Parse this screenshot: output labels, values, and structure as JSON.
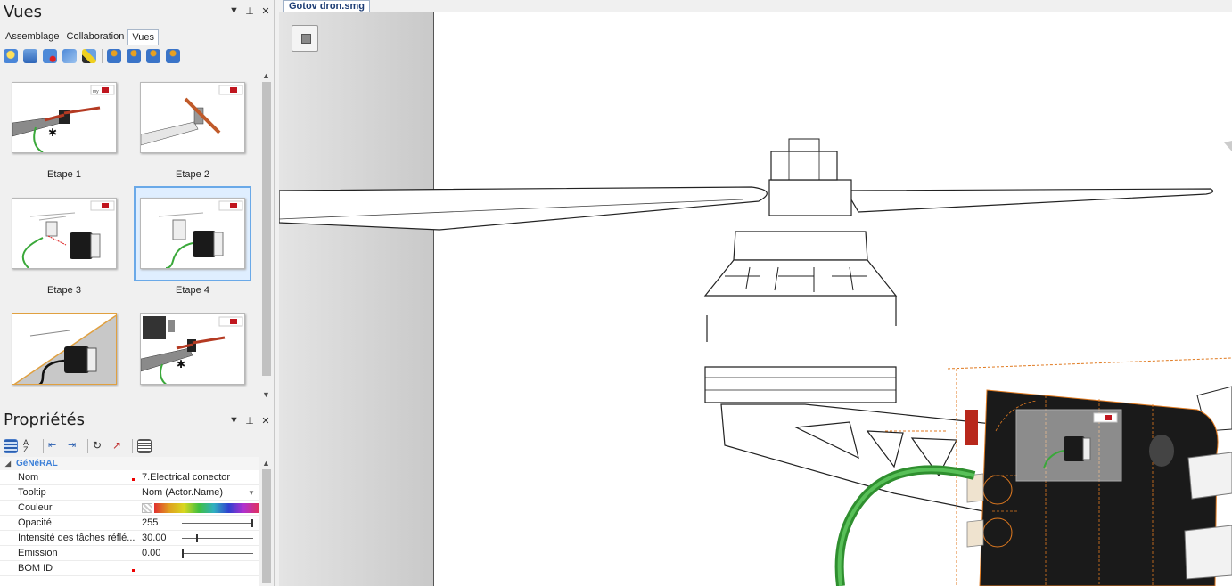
{
  "views_panel": {
    "title": "Vues",
    "tabs": [
      "Assemblage",
      "Collaboration",
      "Vues"
    ],
    "active_tab": "Vues",
    "toolbar_icons": [
      "new-view-icon",
      "camera-view-icon",
      "record-view-icon",
      "refresh-view-icon",
      "paint-view-icon",
      "view-actor-icon-1",
      "view-actor-icon-2",
      "view-actor-icon-3",
      "view-actor-icon-4"
    ],
    "thumbnails": [
      {
        "label": "Etape 1"
      },
      {
        "label": "Etape 2"
      },
      {
        "label": "Etape 3"
      },
      {
        "label": "Etape 4",
        "selected": true
      },
      {
        "label": ""
      },
      {
        "label": ""
      }
    ]
  },
  "props_panel": {
    "title": "Propriétés",
    "toolbar_icons": [
      "categorized-icon",
      "alphabetical-icon",
      "expand-all-icon",
      "collapse-all-icon",
      "reset-icon",
      "pick-icon",
      "add-property-icon"
    ],
    "category": "GéNéRAL",
    "rows": [
      {
        "name": "Nom",
        "value": "7.Electrical conector"
      },
      {
        "name": "Tooltip",
        "value": "Nom (Actor.Name)"
      },
      {
        "name": "Couleur",
        "value": ""
      },
      {
        "name": "Opacité",
        "value": "255",
        "level": 1.0
      },
      {
        "name": "Intensité des tâches réflé...",
        "value": "30.00",
        "level": 0.2
      },
      {
        "name": "Emission",
        "value": "0.00",
        "level": 0.0
      },
      {
        "name": "BOM ID",
        "value": ""
      }
    ]
  },
  "document": {
    "tab": "Gotov dron.smg"
  },
  "colors": {
    "selection": "#6aa9e8",
    "category_text": "#3b7fd8",
    "cable_green": "#3aa83a",
    "housing_black": "#1a1a1a",
    "bracket_orange": "#e07a20"
  }
}
